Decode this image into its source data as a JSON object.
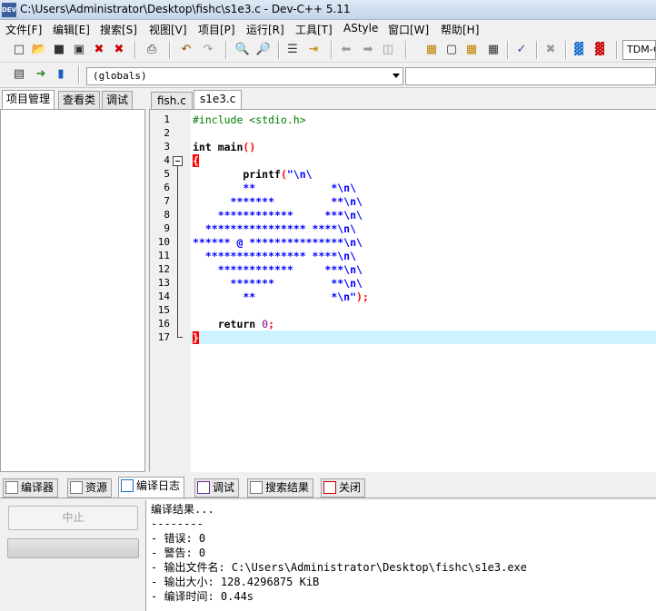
{
  "window": {
    "title": "C:\\Users\\Administrator\\Desktop\\fishc\\s1e3.c - Dev-C++ 5.11",
    "app_icon": "DEV"
  },
  "menu": [
    "文件[F]",
    "编辑[E]",
    "搜索[S]",
    "视图[V]",
    "项目[P]",
    "运行[R]",
    "工具[T]",
    "AStyle",
    "窗口[W]",
    "帮助[H]"
  ],
  "toolbar": {
    "compiler": "TDM-GCC",
    "scope": "(globals)"
  },
  "left_tabs": [
    "项目管理",
    "查看类",
    "调试"
  ],
  "editor_tabs": [
    "fish.c",
    "s1e3.c"
  ],
  "editor": {
    "line_numbers": [
      "1",
      "2",
      "3",
      "4",
      "5",
      "6",
      "7",
      "8",
      "9",
      "10",
      "11",
      "12",
      "13",
      "14",
      "15",
      "16",
      "17"
    ],
    "code": {
      "l1": "#include <stdio.h>",
      "l3_kw": "int",
      "l3_rest": " main",
      "l3_p": "()",
      "l4": "{",
      "l5_a": "        printf",
      "l5_b": "(",
      "l5_c": "\"\\n\\",
      "l6": "        **            *\\n\\",
      "l7": "      *******         **\\n\\",
      "l8": "    ************     ***\\n\\",
      "l9": "  **************** ****\\n\\",
      "l10": "****** @ ***************\\n\\",
      "l11": "  **************** ****\\n\\",
      "l12": "    ************     ***\\n\\",
      "l13": "      *******         **\\n\\",
      "l14_a": "        **            *\\n\"",
      "l14_b": ");",
      "l16_kw": "    return",
      "l16_num": " 0",
      "l16_p": ";",
      "l17": "}"
    }
  },
  "bottom_tabs": [
    "编译器",
    "资源",
    "编译日志",
    "调试",
    "搜索结果",
    "关闭"
  ],
  "bottom": {
    "stop_label": "中止",
    "log": [
      "编译结果...",
      "--------",
      "- 错误: 0",
      "- 警告: 0",
      "- 输出文件名: C:\\Users\\Administrator\\Desktop\\fishc\\s1e3.exe",
      "- 输出大小: 128.4296875 KiB",
      "- 编译时间: 0.44s"
    ]
  }
}
